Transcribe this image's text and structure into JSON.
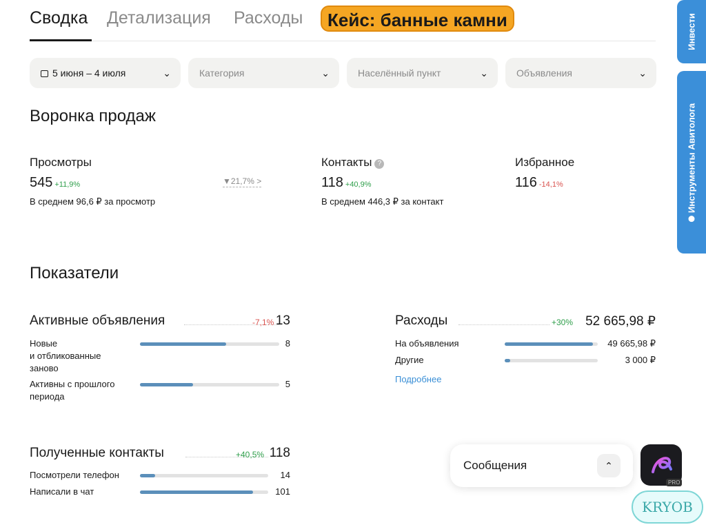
{
  "tabs": {
    "summary": "Сводка",
    "details": "Детализация",
    "expenses": "Расходы",
    "case": "Кейс: банные камни"
  },
  "filters": {
    "period": "5 июня – 4 июля",
    "category": "Категория",
    "location": "Населённый пункт",
    "listings": "Объявления"
  },
  "funnel": {
    "title": "Воронка продаж",
    "views": {
      "label": "Просмотры",
      "value": "545",
      "delta": "+11,9%",
      "sub": "В среднем 96,6 ₽ за просмотр"
    },
    "conversion": "▼21,7% >",
    "contacts": {
      "label": "Контакты",
      "help": "?",
      "value": "118",
      "delta": "+40,9%",
      "sub": "В среднем 446,3 ₽ за контакт"
    },
    "favorites": {
      "label": "Избранное",
      "value": "116",
      "delta": "-14,1%"
    }
  },
  "indicators": {
    "title": "Показатели",
    "active_listings": {
      "name": "Активные объявления",
      "pct": "-7,1%",
      "total": "13",
      "rows": [
        {
          "label": "Новые\nи отбликованные\nзаново",
          "value": "8",
          "fill": 0.62
        },
        {
          "label": "Активны с прошлого\nпериода",
          "value": "5",
          "fill": 0.38
        }
      ]
    },
    "expenses": {
      "name": "Расходы",
      "pct": "+30%",
      "total": "52 665,98 ₽",
      "rows": [
        {
          "label": "На объявления",
          "value": "49 665,98 ₽",
          "fill": 0.95
        },
        {
          "label": "Другие",
          "value": "3 000 ₽",
          "fill": 0.06
        }
      ],
      "more": "Подробнее"
    },
    "contacts_received": {
      "name": "Полученные контакты",
      "pct": "+40,5%",
      "total": "118",
      "rows": [
        {
          "label": "Посмотрели телефон",
          "value": "14",
          "fill": 0.12
        },
        {
          "label": "Написали в чат",
          "value": "101",
          "fill": 0.88
        }
      ]
    }
  },
  "side": {
    "investments": "Инвести",
    "avito_tools": "Инструменты Авитолога"
  },
  "messages": {
    "label": "Сообщения"
  },
  "app": {
    "badge": "PRO"
  },
  "watermark": "KRYOB",
  "colors": {
    "accent": "#5b8fba",
    "positive": "#2e9e4a",
    "negative": "#d9534f",
    "side_tab": "#3b8fd9",
    "case_badge": "#f5a623"
  }
}
